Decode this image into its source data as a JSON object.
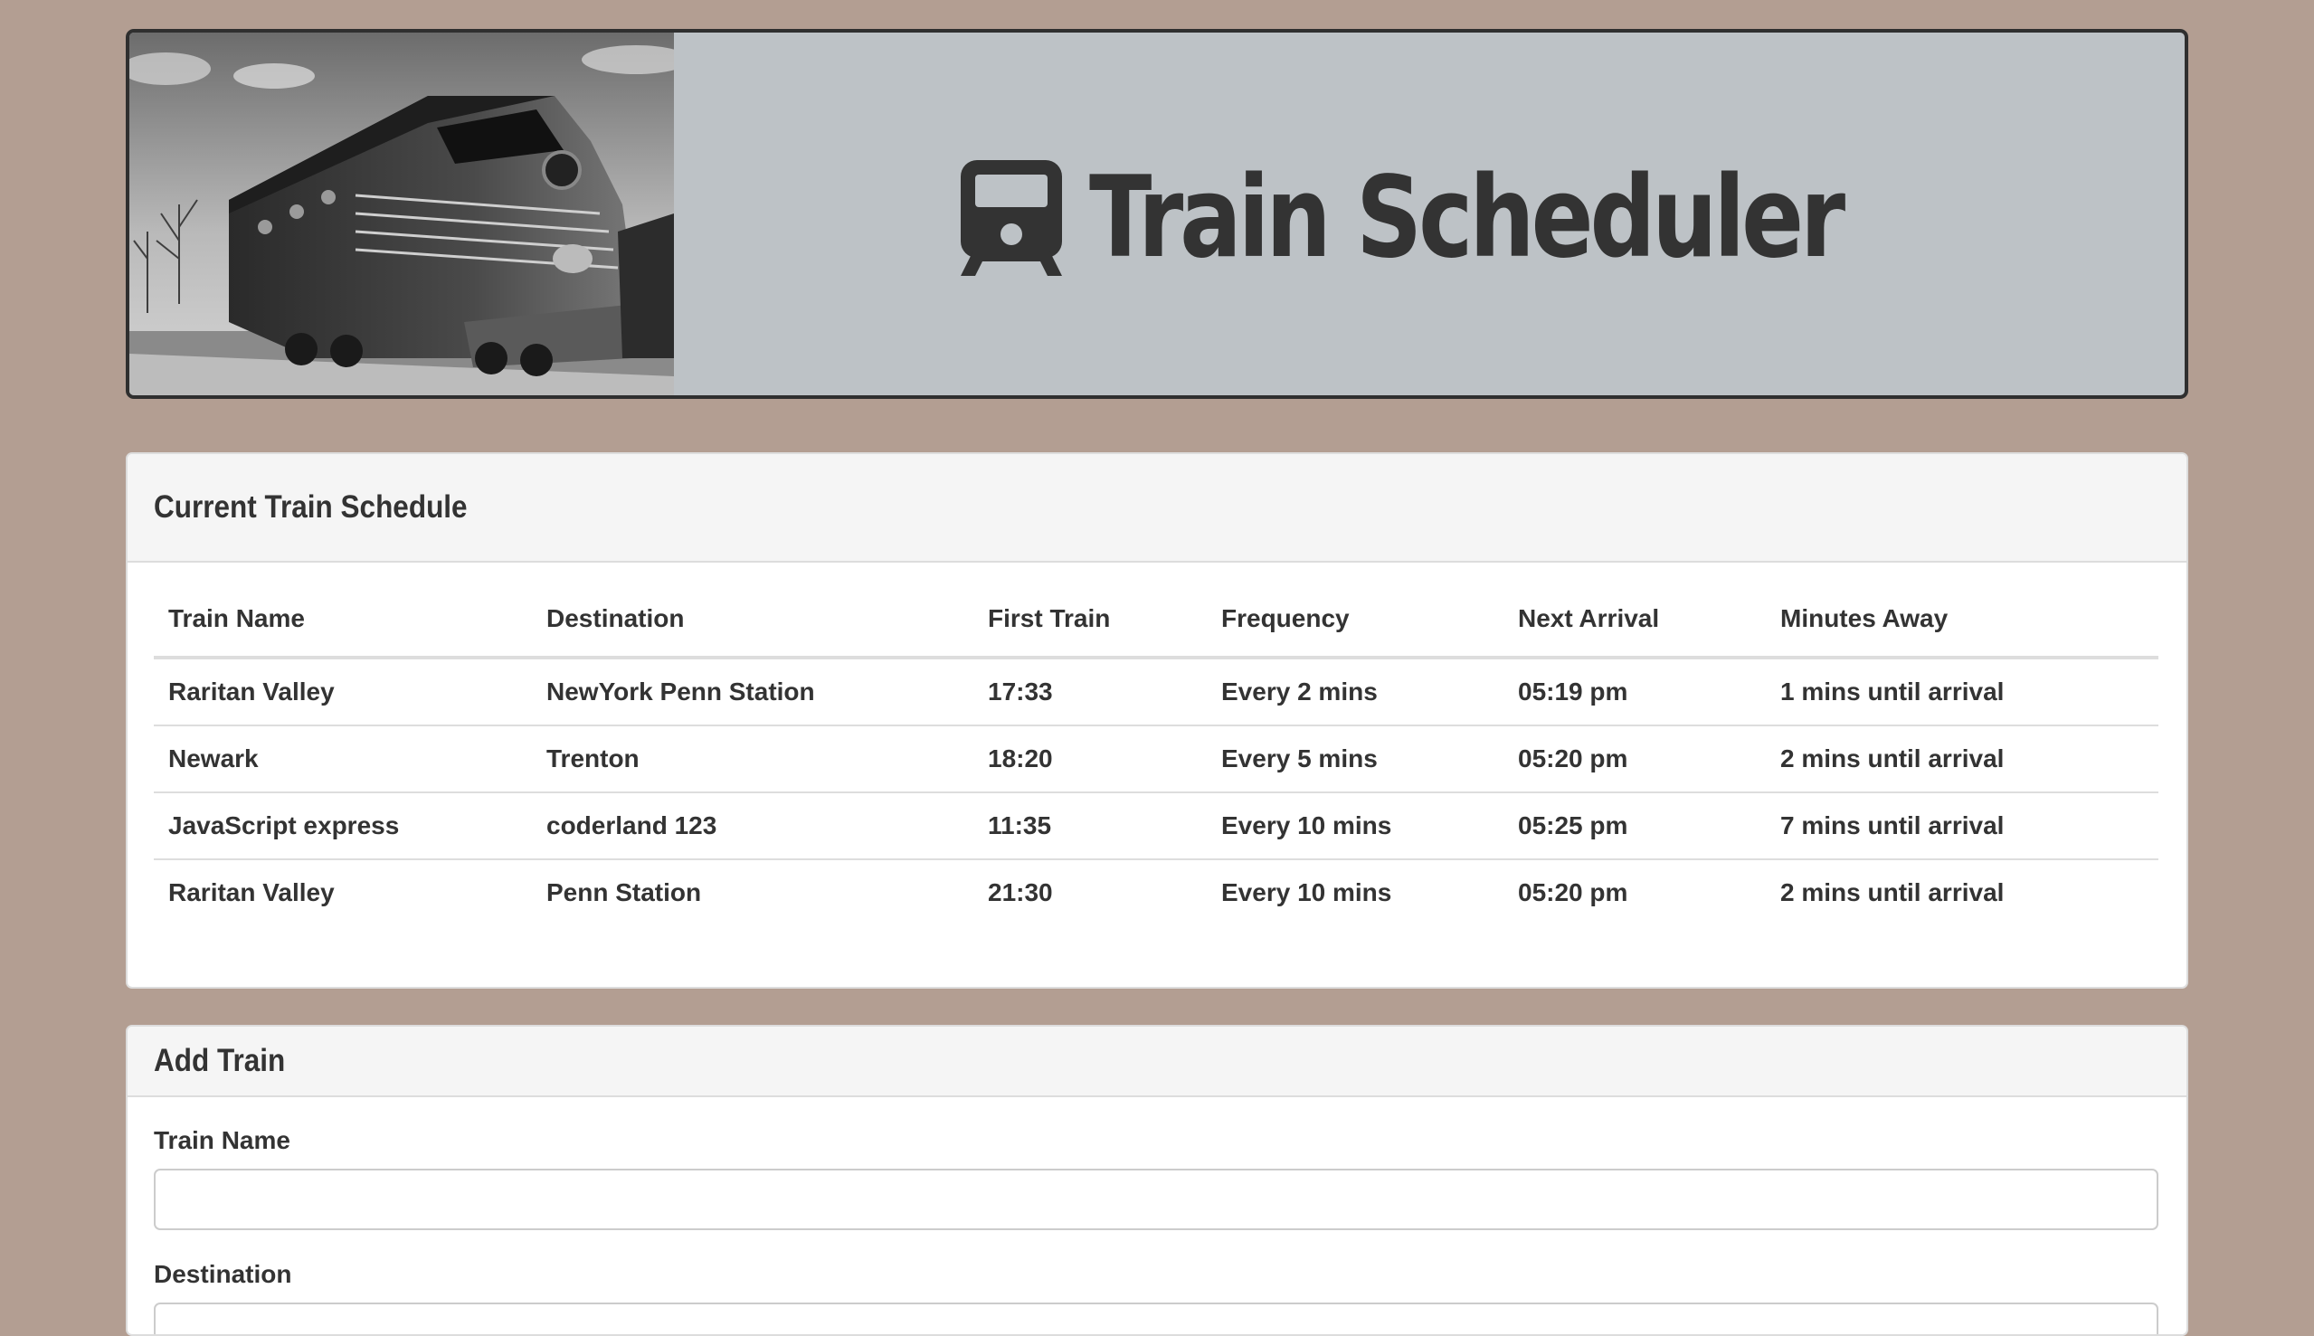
{
  "header": {
    "title": "Train Scheduler",
    "icon": "train-icon",
    "photo": "locomotive-photo"
  },
  "schedule": {
    "heading": "Current Train Schedule",
    "columns": [
      "Train Name",
      "Destination",
      "First Train",
      "Frequency",
      "Next Arrival",
      "Minutes Away"
    ],
    "rows": [
      [
        "Raritan Valley",
        "NewYork Penn Station",
        "17:33",
        "Every 2 mins",
        "05:19 pm",
        "1 mins until arrival"
      ],
      [
        "Newark",
        "Trenton",
        "18:20",
        "Every 5 mins",
        "05:20 pm",
        "2 mins until arrival"
      ],
      [
        "JavaScript express",
        "coderland 123",
        "11:35",
        "Every 10 mins",
        "05:25 pm",
        "7 mins until arrival"
      ],
      [
        "Raritan Valley",
        "Penn Station",
        "21:30",
        "Every 10 mins",
        "05:20 pm",
        "2 mins until arrival"
      ]
    ]
  },
  "add_train": {
    "heading": "Add Train",
    "train_name_label": "Train Name",
    "train_name_value": "",
    "train_name_placeholder": "",
    "destination_label": "Destination",
    "destination_value": "",
    "destination_placeholder": ""
  },
  "colors": {
    "page_background": "#b39e92",
    "banner_background": "#bdc2c6",
    "text": "#333333",
    "panel_heading": "#f5f5f5",
    "border": "#dddddd"
  }
}
